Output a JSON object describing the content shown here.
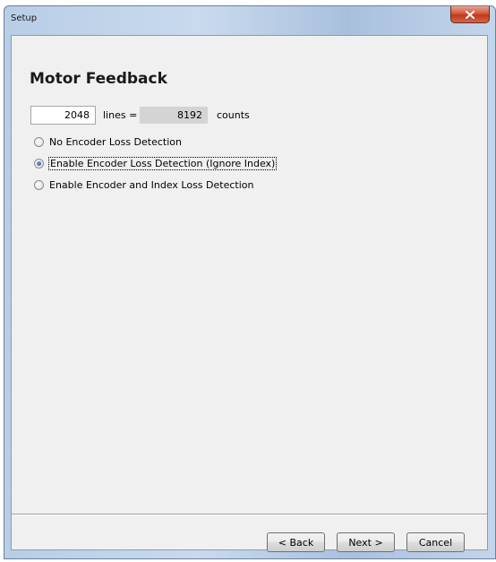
{
  "window": {
    "title": "Setup",
    "close_glyph": "x"
  },
  "page": {
    "heading": "Motor Feedback"
  },
  "conversion": {
    "lines_value": "2048",
    "lines_label": "lines =",
    "counts_value": "8192",
    "counts_label": "counts"
  },
  "options": [
    {
      "label": "No Encoder Loss Detection",
      "checked": false
    },
    {
      "label": "Enable Encoder Loss Detection (Ignore Index)",
      "checked": true
    },
    {
      "label": "Enable Encoder and Index Loss Detection",
      "checked": false
    }
  ],
  "buttons": {
    "back": "< Back",
    "next": "Next >",
    "cancel": "Cancel"
  },
  "colors": {
    "titlebar": "#c2d5ec",
    "close": "#c1391b",
    "client_bg": "#f0f0f0",
    "readonly_field": "#d4d4d4"
  }
}
